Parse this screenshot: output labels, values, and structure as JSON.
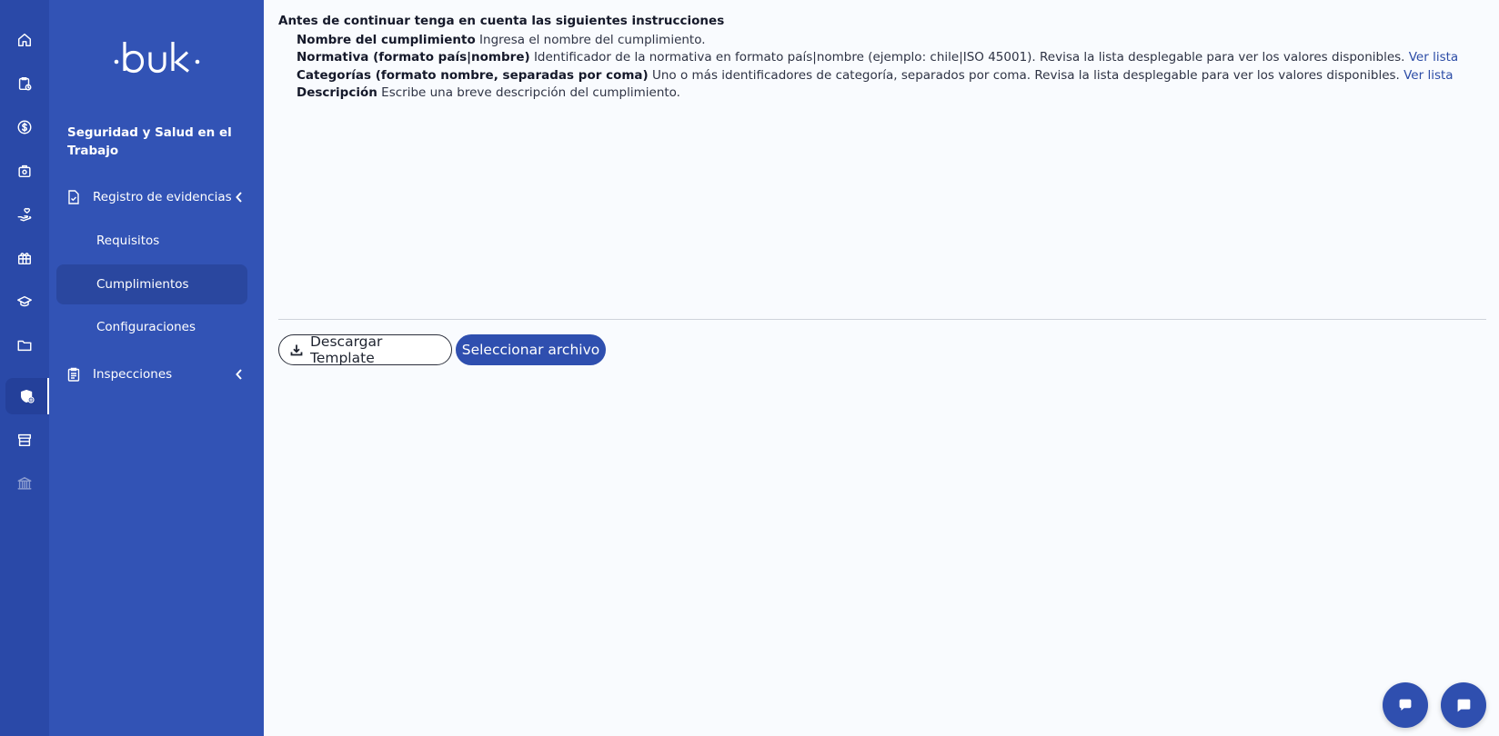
{
  "brand": {
    "logo_text": "·buk·"
  },
  "rail": {
    "icons": [
      "home-icon",
      "clipboard-clock-icon",
      "dollar-circle-icon",
      "briefcase-icon",
      "hand-heart-icon",
      "gift-icon",
      "graduation-cap-icon",
      "folder-icon",
      "shield-health-icon",
      "store-icon",
      "bank-icon"
    ],
    "active": "shield-health-icon"
  },
  "sidebar": {
    "module_title": "Seguridad y Salud en el Trabajo",
    "groups": [
      {
        "label": "Registro de evidencias",
        "icon": "file-check-icon"
      },
      {
        "label": "Inspecciones",
        "icon": "clipboard-list-icon"
      }
    ],
    "sub_items": [
      {
        "label": "Requisitos"
      },
      {
        "label": "Cumplimientos"
      },
      {
        "label": "Configuraciones"
      }
    ],
    "active_item": "Cumplimientos"
  },
  "instructions": {
    "title": "Antes de continuar tenga en cuenta las siguientes instrucciones",
    "items": [
      {
        "term": "Nombre del cumplimiento",
        "text": " Ingresa el nombre del cumplimiento.",
        "link": ""
      },
      {
        "term": "Normativa (formato país|nombre)",
        "text": " Identificador de la normativa en formato país|nombre (ejemplo: chile|ISO 45001). Revisa la lista desplegable para ver los valores disponibles. ",
        "link": "Ver lista"
      },
      {
        "term": "Categorías (formato nombre, separadas por coma)",
        "text": " Uno o más identificadores de categoría, separados por coma. Revisa la lista desplegable para ver los valores disponibles. ",
        "link": "Ver lista"
      },
      {
        "term": "Descripción",
        "text": " Escribe una breve descripción del cumplimiento.",
        "link": ""
      }
    ]
  },
  "actions": {
    "download_label": "Descargar Template",
    "select_file_label": "Seleccionar archivo"
  },
  "floating": {
    "icons": [
      "chat-bubble-icon",
      "message-icon"
    ]
  },
  "colors": {
    "rail_bg": "#2a49a8",
    "sidebar_bg": "#3253b5",
    "active_item_bg": "#2a479f",
    "primary": "#2f4faf",
    "link": "#2c4ca6"
  }
}
